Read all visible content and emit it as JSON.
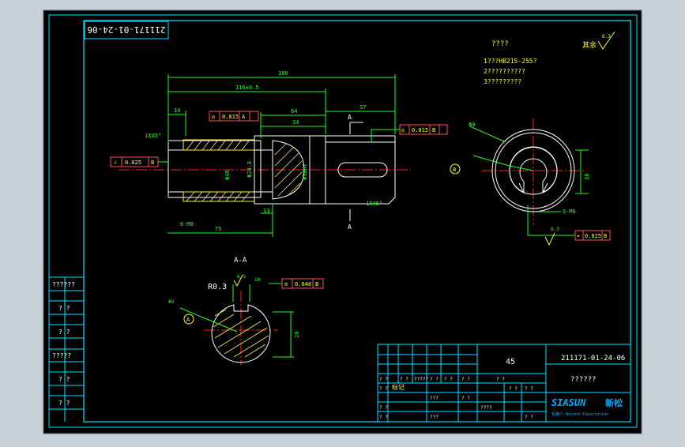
{
  "drawing": {
    "part_number": "211171-01-24-06",
    "reversed_part_number": "211171-01-24-06"
  },
  "notes": {
    "title": "????",
    "line1": "1???HB215-255?",
    "line2": "2??????????",
    "line3": "3?????????"
  },
  "roughness_symbol": "其余",
  "roughness_value": "6.3",
  "dimensions": {
    "total_length": "180",
    "length_b": "116±0.5",
    "d14": "14",
    "d37": "37",
    "d64": "64",
    "d34": "34",
    "d13": "13",
    "d75": "75",
    "chamfer_left": "1X45°",
    "chamfer_right": "1X45°",
    "phi48_1": "Φ48",
    "phi24_8": "Φ24.8",
    "bore": "Φ30H7",
    "phi9": "Φ9",
    "r03": "R0.3",
    "width_10_1": "10",
    "width_13": "13",
    "dim_38": "38",
    "dim_20": "20",
    "thread": "6-M8",
    "section_label": "A-A",
    "section_A1": "A",
    "section_A2": "A",
    "datum_B": "B",
    "datum_A": "A"
  },
  "tolerances": {
    "left_flat": {
      "symbol": "∠",
      "value": "0.025",
      "datum": "B"
    },
    "top_concentric": {
      "symbol": "◎",
      "value": "0.015",
      "datum": "A"
    },
    "right_concentric": {
      "symbol": "◎",
      "value": "0.015",
      "datum": "B"
    },
    "circle_position": {
      "symbol": "⌖",
      "value": "0.025",
      "datum": "B"
    },
    "section_sym": {
      "symbol": "≡",
      "value": "0.048",
      "datum": "B"
    }
  },
  "left_column": {
    "labels": [
      "??????",
      "? ?",
      "? ?",
      "?????",
      "? ?",
      "? ?"
    ]
  },
  "title_block": {
    "material": "45",
    "drawing_no": "211171-01-24-06",
    "part_name": "??????",
    "company": "SIASUN",
    "company_cn": "新松",
    "company_slogan": "机器人  Beyond Expectation",
    "cells": [
      "? ?",
      "? ?",
      "?????",
      "? ?",
      "? ?",
      "? ?",
      "? ?",
      "? ?",
      "???",
      "? ?",
      "? ?",
      "????",
      "???",
      "? ?",
      "? ?",
      "? ?",
      "? ?"
    ],
    "stamp_label": "标记"
  },
  "colors": {
    "background": "#000000",
    "frame": "#00e5ff",
    "geometry": "#ffffff",
    "dimension": "#22ff22",
    "center": "#ff2020",
    "highlight": "#ffff33",
    "tolerance": "#ff5050",
    "hatch": "#ffee44",
    "logo": "#00aaff"
  }
}
